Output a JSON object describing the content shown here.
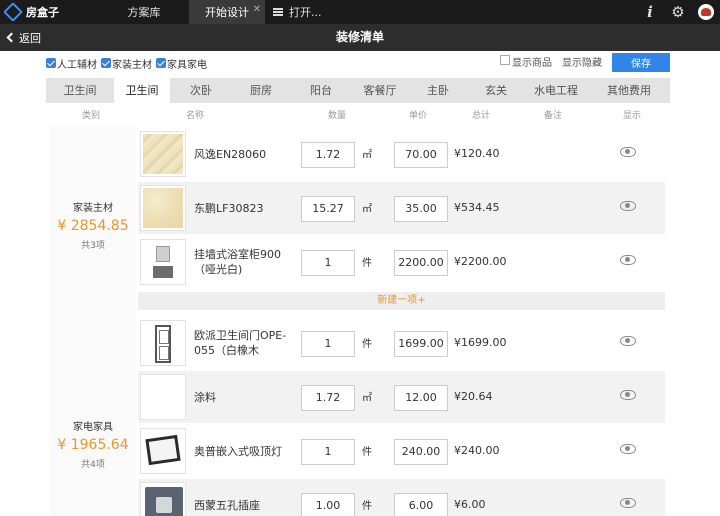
{
  "app": {
    "logo_text": "房盒子",
    "tabs": [
      {
        "label": "方案库"
      },
      {
        "label": "开始设计"
      },
      {
        "label": "打开..."
      }
    ],
    "close_glyph": "✕"
  },
  "titlebar": {
    "back_label": "返回",
    "title": "装修清单"
  },
  "filters": {
    "checkboxes": [
      {
        "label": "人工辅材",
        "checked": true
      },
      {
        "label": "家装主材",
        "checked": true
      },
      {
        "label": "家具家电",
        "checked": true
      }
    ],
    "show_products": "显示商品",
    "show_hidden": "显示隐藏",
    "save_label": "保存"
  },
  "room_tabs": [
    {
      "label": "卫生间",
      "active": false
    },
    {
      "label": "卫生间",
      "active": true
    },
    {
      "label": "次卧",
      "active": false
    },
    {
      "label": "厨房",
      "active": false
    },
    {
      "label": "阳台",
      "active": false
    },
    {
      "label": "客餐厅",
      "active": false
    },
    {
      "label": "主卧",
      "active": false
    },
    {
      "label": "玄关",
      "active": false
    },
    {
      "label": "水电工程",
      "active": false
    },
    {
      "label": "其他费用",
      "active": false
    }
  ],
  "table": {
    "headers": {
      "category": "类别",
      "name": "名称",
      "quantity": "数量",
      "unit_price": "单价",
      "total": "总计",
      "remark": "备注",
      "display": "显示"
    },
    "groups": [
      {
        "name": "家装主材",
        "total": "¥ 2854.85",
        "count": "共3项",
        "items": [
          {
            "name": "风逸EN28060",
            "qty": "1.72",
            "unit": "㎡",
            "price": "70.00",
            "total": "¥120.40",
            "thumb": "tile-icon"
          },
          {
            "name": "东鹏LF30823",
            "qty": "15.27",
            "unit": "㎡",
            "price": "35.00",
            "total": "¥534.45",
            "thumb": "tile-icon"
          },
          {
            "name": "挂墙式浴室柜900（哑光白)",
            "qty": "1",
            "unit": "件",
            "price": "2200.00",
            "total": "¥2200.00",
            "thumb": "bathroom-cabinet-icon"
          }
        ],
        "new_item_label": "新建一项+"
      },
      {
        "name": "家电家具",
        "total": "¥ 1965.64",
        "count": "共4项",
        "items": [
          {
            "name": "欧派卫生间门OPE-055（白橡木",
            "qty": "1",
            "unit": "件",
            "price": "1699.00",
            "total": "¥1699.00",
            "thumb": "door-icon"
          },
          {
            "name": "涂料",
            "qty": "1.72",
            "unit": "㎡",
            "price": "12.00",
            "total": "¥20.64",
            "thumb": "blank-thumb"
          },
          {
            "name": "奥普嵌入式吸顶灯",
            "qty": "1",
            "unit": "件",
            "price": "240.00",
            "total": "¥240.00",
            "thumb": "ceiling-lamp-icon"
          },
          {
            "name": "西蒙五孔插座",
            "qty": "1.00",
            "unit": "件",
            "price": "6.00",
            "total": "¥6.00",
            "thumb": "socket-icon"
          }
        ]
      }
    ]
  }
}
